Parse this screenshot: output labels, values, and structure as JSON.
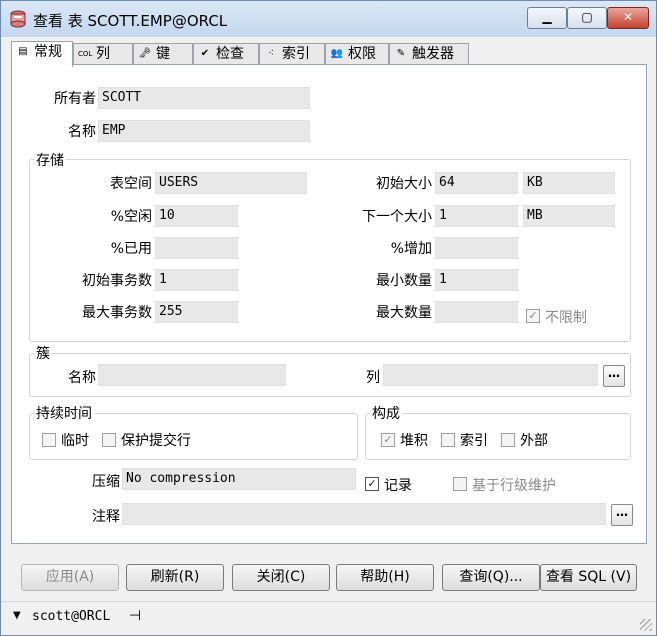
{
  "window": {
    "title": "查看 表 SCOTT.EMP@ORCL",
    "min_glyph": "▁",
    "max_glyph": "▢",
    "close_glyph": "✕"
  },
  "tabs": [
    {
      "label": "常规",
      "icon": "general-icon",
      "glyph": "▤"
    },
    {
      "label": "列",
      "icon": "columns-icon",
      "glyph": "COL"
    },
    {
      "label": "键",
      "icon": "key-icon",
      "glyph": "🗝"
    },
    {
      "label": "检查",
      "icon": "check-icon",
      "glyph": "✔"
    },
    {
      "label": "索引",
      "icon": "index-icon",
      "glyph": "⁖"
    },
    {
      "label": "权限",
      "icon": "users-icon",
      "glyph": "👥"
    },
    {
      "label": "触发器",
      "icon": "trigger-icon",
      "glyph": "✎"
    }
  ],
  "general": {
    "owner_label": "所有者",
    "owner_value": "SCOTT",
    "name_label": "名称",
    "name_value": "EMP"
  },
  "storage": {
    "group_label": "存储",
    "tablespace_label": "表空间",
    "tablespace_value": "USERS",
    "pctfree_label": "%空闲",
    "pctfree_value": "10",
    "pctused_label": "%已用",
    "pctused_value": "",
    "initrans_label": "初始事务数",
    "initrans_value": "1",
    "maxtrans_label": "最大事务数",
    "maxtrans_value": "255",
    "initial_label": "初始大小",
    "initial_value": "64",
    "initial_unit": "KB",
    "next_label": "下一个大小",
    "next_value": "1",
    "next_unit": "MB",
    "pctinc_label": "%增加",
    "pctinc_value": "",
    "minext_label": "最小数量",
    "minext_value": "1",
    "maxext_label": "最大数量",
    "maxext_value": "",
    "unlimited_label": "不限制",
    "unlimited_checked": true
  },
  "cluster": {
    "group_label": "簇",
    "name_label": "名称",
    "name_value": "",
    "columns_label": "列",
    "columns_value": "",
    "browse_glyph": "…"
  },
  "duration": {
    "group_label": "持续时间",
    "temporary_label": "临时",
    "preserve_label": "保护提交行"
  },
  "organization": {
    "group_label": "构成",
    "heap_label": "堆积",
    "heap_checked": true,
    "index_label": "索引",
    "external_label": "外部"
  },
  "compression": {
    "label": "压缩",
    "value": "No compression"
  },
  "logging": {
    "label": "记录",
    "checked": true
  },
  "rowdep": {
    "label": "基于行级维护"
  },
  "comment": {
    "label": "注释",
    "value": "",
    "browse_glyph": "…"
  },
  "buttons": {
    "apply": "应用(A)",
    "refresh": "刷新(R)",
    "close": "关闭(C)",
    "help": "帮助(H)",
    "query": "查询(Q)...",
    "view_sql": "查看 SQL (V)"
  },
  "status": {
    "connection": "scott@ORCL",
    "arrow_glyph": "▼",
    "pin_glyph": "⊣"
  },
  "check_glyph": "✓"
}
